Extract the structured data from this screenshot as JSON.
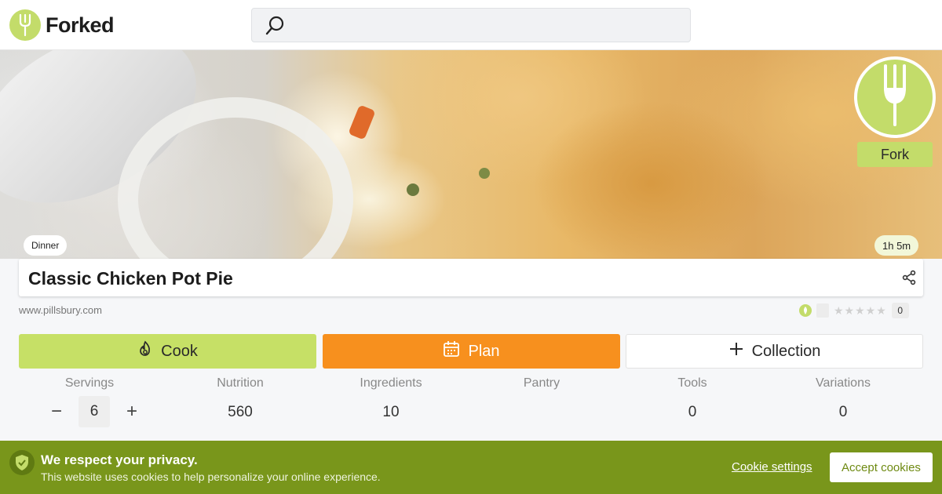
{
  "header": {
    "logo_text": "Forked",
    "search": {
      "placeholder": "",
      "value": ""
    }
  },
  "hero": {
    "category": "Dinner",
    "total_time": "1h 5m",
    "fork_label": "Fork"
  },
  "recipe": {
    "title": "Classic Chicken Pot Pie",
    "source": "www.pillsbury.com",
    "rating_count": "0",
    "stars": "★★★★★"
  },
  "actions": {
    "cook_label": "Cook",
    "plan_label": "Plan",
    "collection_label": "Collection"
  },
  "stats": [
    {
      "label": "Servings",
      "value": "6"
    },
    {
      "label": "Nutrition",
      "value": "560"
    },
    {
      "label": "Ingredients",
      "value": "10"
    },
    {
      "label": "Pantry",
      "value": ""
    },
    {
      "label": "Tools",
      "value": "0"
    },
    {
      "label": "Variations",
      "value": "0"
    }
  ],
  "servings_controls": {
    "minus": "−",
    "plus": "+"
  },
  "cookie_banner": {
    "title": "We respect your privacy.",
    "text": "This website uses cookies to help personalize your online experience.",
    "settings_label": "Cookie settings",
    "accept_label": "Accept cookies"
  },
  "colors": {
    "brand_green": "#c3dc6a",
    "cook_green": "#c6e066",
    "plan_orange": "#f7901e",
    "cookie_green": "#79961b"
  }
}
